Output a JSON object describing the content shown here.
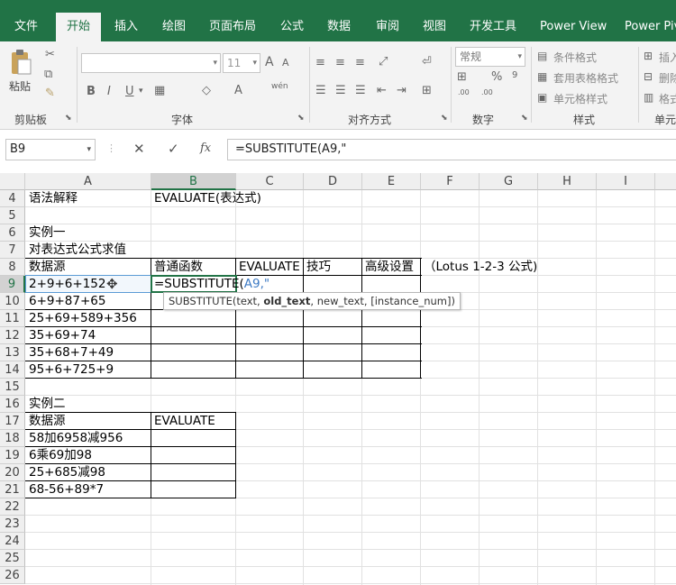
{
  "tabs": [
    "文件",
    "开始",
    "插入",
    "绘图",
    "页面布局",
    "公式",
    "数据",
    "审阅",
    "视图",
    "开发工具",
    "Power View",
    "Power Piv"
  ],
  "ribbon": {
    "paste": "粘贴",
    "clipboard": "剪贴板",
    "font_group": "字体",
    "align_group": "对齐方式",
    "number_group": "数字",
    "style_group": "样式",
    "cells_group": "单元",
    "font_size": "11",
    "number_format": "常规",
    "cond_format": "条件格式",
    "table_format": "套用表格格式",
    "cell_style": "单元格样式",
    "insert": "插入",
    "delete": "删除",
    "format": "格式",
    "percent": "%",
    "wen": "wén"
  },
  "formula_bar": {
    "name_box": "B9",
    "fx": "fx",
    "formula": "=SUBSTITUTE(A9,\""
  },
  "columns": [
    "A",
    "B",
    "C",
    "D",
    "E",
    "F",
    "G",
    "H",
    "I"
  ],
  "rows": [
    "4",
    "5",
    "6",
    "7",
    "8",
    "9",
    "10",
    "11",
    "12",
    "13",
    "14",
    "15",
    "16",
    "17",
    "18",
    "19",
    "20",
    "21",
    "22",
    "23",
    "24",
    "25",
    "26"
  ],
  "cells": {
    "a4": "语法解释",
    "b4": "EVALUATE(表达式)",
    "a6": "实例一",
    "a7": "对表达式公式求值",
    "a8": "数据源",
    "b8": "普通函数",
    "c8": "EVALUATE",
    "d8": "技巧",
    "e8": "高级设置",
    "f8": "（Lotus 1-2-3 公式)",
    "a9": "2+9+6+152",
    "b9": "=SUBSTITUTE(",
    "b9ref": "A9,\"",
    "a10": "6+9+87+65",
    "a11": "25+69+589+356",
    "a12": "35+69+74",
    "a13": "35+68+7+49",
    "a14": "95+6+725+9",
    "a16": "实例二",
    "a17": "数据源",
    "b17": "EVALUATE",
    "a18": "58加6958减956",
    "a19": "6乘69加98",
    "a20": "25+685减98",
    "a21": "68-56+89*7"
  },
  "tooltip": {
    "fn": "SUBSTITUTE(",
    "a1": "text, ",
    "a2": "old_text",
    "a3": ", new_text, [instance_num])"
  }
}
